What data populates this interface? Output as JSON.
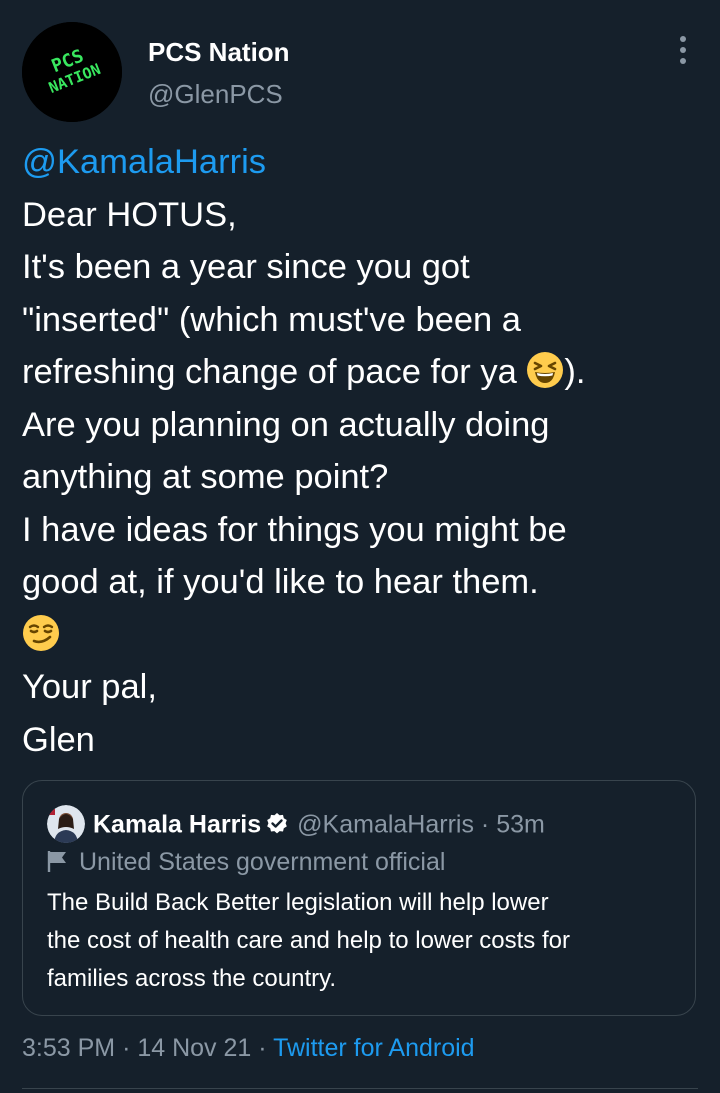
{
  "tweet": {
    "author": {
      "display_name": "PCS Nation",
      "handle": "@GlenPCS",
      "avatar_text_top": "PCS",
      "avatar_text_bottom": "NATION"
    },
    "mention": "@KamalaHarris",
    "lines": [
      "Dear HOTUS,",
      "It's been a year since you got",
      "\"inserted\" (which must've been a",
      "refreshing change of pace for ya ",
      ").",
      " Are you planning on actually doing",
      "anything at some point?",
      "I have ideas for things you might be",
      "good at, if you'd like to hear them.",
      "Your pal,",
      "Glen"
    ],
    "emojis": {
      "laughing": "laughing-squinting-face",
      "smirk": "smirking-face"
    },
    "time": "3:53 PM",
    "separator": "·",
    "date": "14 Nov 21",
    "source": "Twitter for Android"
  },
  "quoted_tweet": {
    "display_name": "Kamala Harris",
    "handle": "@KamalaHarris",
    "separator": "·",
    "time": "53m",
    "label": "United States government official",
    "text_lines": [
      "The Build Back Better legislation will help lower",
      "the cost of health care and help to lower costs for",
      "families across the country."
    ]
  },
  "colors": {
    "background": "#15202b",
    "text": "#ffffff",
    "secondary_text": "#8b98a5",
    "accent": "#1d9bf0",
    "border": "#38444d",
    "avatar_lettering": "#39e75f"
  }
}
